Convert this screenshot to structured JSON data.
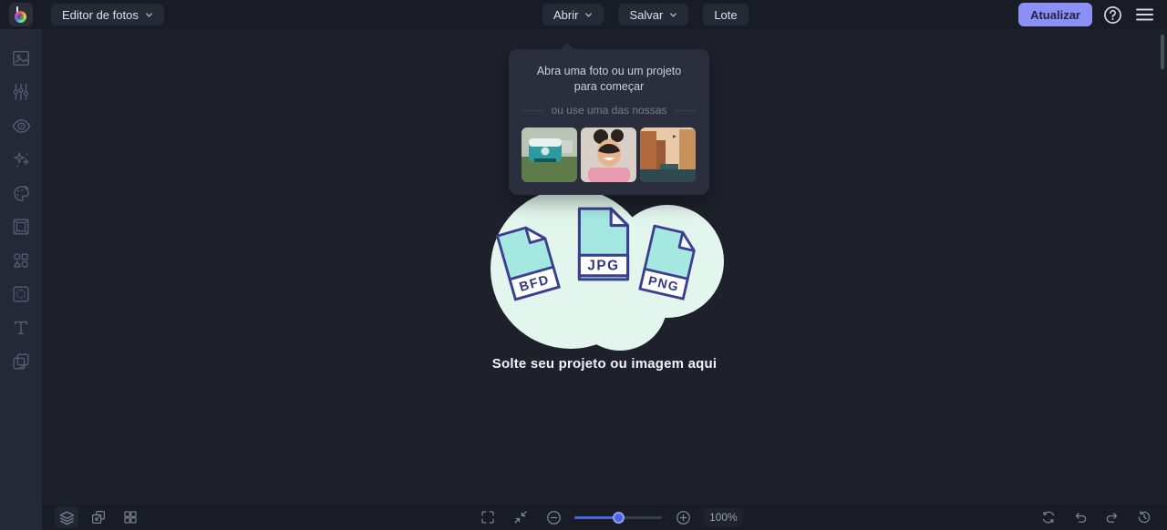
{
  "colors": {
    "accent": "#8b90f7",
    "topbar_bg": "#191b25",
    "canvas_bg": "#1e202b",
    "sidebar_bg": "#252836",
    "popover_bg": "#2b2e3c",
    "slider_fill": "#4a63de",
    "file_fill": "#a5e8e1",
    "file_outline": "#3c3f8e",
    "blob_fill": "#e3f6ee"
  },
  "header": {
    "editor_menu_label": "Editor de fotos",
    "open_label": "Abrir",
    "save_label": "Salvar",
    "batch_label": "Lote",
    "upgrade_label": "Atualizar",
    "help_icon": "question-mark-circle",
    "menu_icon": "hamburger-menu"
  },
  "sidebar": {
    "items": [
      {
        "icon": "photo-image-icon"
      },
      {
        "icon": "edit-sliders-icon"
      },
      {
        "icon": "touchup-eye-icon"
      },
      {
        "icon": "effects-sparkles-icon"
      },
      {
        "icon": "artsy-palette-icon"
      },
      {
        "icon": "frames-icon"
      },
      {
        "icon": "graphics-shapes-icon"
      },
      {
        "icon": "textures-icon"
      },
      {
        "icon": "text-icon"
      },
      {
        "icon": "overlays-icon"
      }
    ]
  },
  "popover": {
    "title": "Abra uma foto ou um projeto para começar",
    "subtitle": "ou use uma das nossas",
    "samples": [
      {
        "name": "teal-van-photo"
      },
      {
        "name": "smiling-woman-photo"
      },
      {
        "name": "venice-canal-photo"
      }
    ]
  },
  "dropzone": {
    "file_labels": [
      "BFD",
      "JPG",
      "PNG"
    ],
    "label": "Solte seu projeto ou imagem aqui"
  },
  "bottombar": {
    "zoom_value": "100%",
    "icons_left": [
      "layers-icon",
      "resize-canvas-icon",
      "grid-icon"
    ],
    "icons_center": [
      "expand-icon",
      "fit-screen-icon",
      "zoom-out-icon",
      "zoom-in-icon"
    ],
    "icons_right": [
      "reset-icon",
      "undo-icon",
      "redo-icon",
      "history-icon"
    ]
  }
}
